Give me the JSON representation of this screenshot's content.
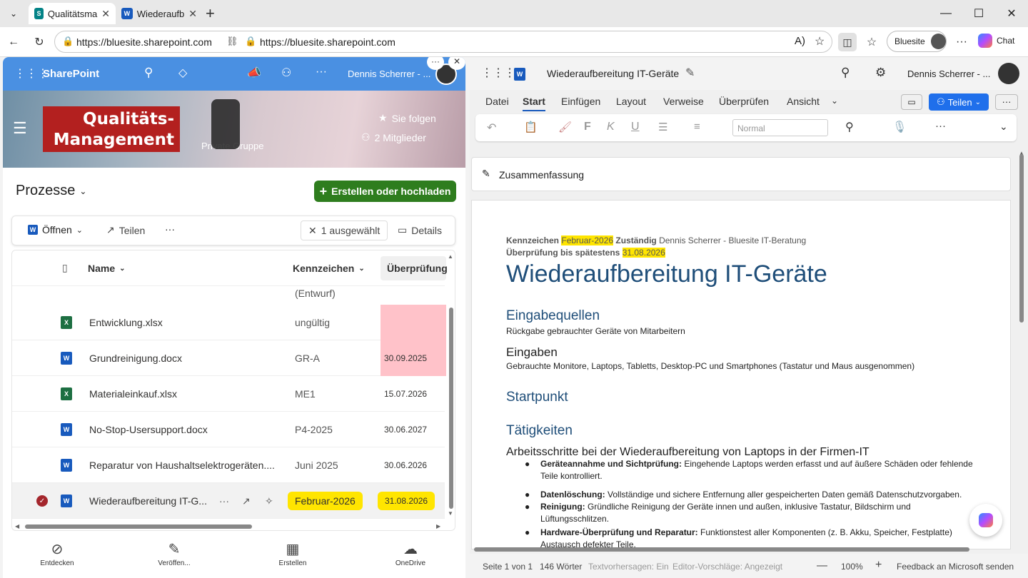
{
  "browser": {
    "tabs": [
      {
        "title": "Qualitätsma",
        "favicon": "S"
      },
      {
        "title": "Wiederaufb",
        "favicon": "W"
      }
    ],
    "url_left": "https://bluesite.sharepoint.com",
    "url_right": "https://bluesite.sharepoint.com",
    "profile": "Bluesite",
    "chat": "Chat"
  },
  "sharepoint": {
    "app": "SharePoint",
    "user": "Dennis Scherrer - ...",
    "site_logo_line1": "Qualitäts-",
    "site_logo_line2": "Management",
    "group_type": "Private Gruppe",
    "follow": "Sie folgen",
    "members": "2 Mitglieder",
    "library": "Prozesse",
    "create_button": "Erstellen oder hochladen",
    "cmd": {
      "open": "Öffnen",
      "share": "Teilen",
      "more": "···",
      "selected": "1 ausgewählt",
      "details": "Details"
    },
    "columns": {
      "name": "Name",
      "kennzeichen": "Kennzeichen",
      "ueberpruefung": "Überprüfung"
    },
    "partial_row": "(Entwurf)",
    "rows": [
      {
        "name": "Entwicklung.xlsx",
        "type": "xlsx",
        "kennzeichen": "ungültig",
        "ueberpruefung": "",
        "flag": "red"
      },
      {
        "name": "Grundreinigung.docx",
        "type": "docx",
        "kennzeichen": "GR-A",
        "ueberpruefung": "30.09.2025",
        "flag": "red"
      },
      {
        "name": "Materialeinkauf.xlsx",
        "type": "xlsx",
        "kennzeichen": "ME1",
        "ueberpruefung": "15.07.2026",
        "flag": ""
      },
      {
        "name": "No-Stop-Usersupport.docx",
        "type": "docx",
        "kennzeichen": "P4-2025",
        "ueberpruefung": "30.06.2027",
        "flag": ""
      },
      {
        "name": "Reparatur von Haushaltselektrogeräten....",
        "type": "docx",
        "kennzeichen": "Juni 2025",
        "ueberpruefung": "30.06.2026",
        "flag": ""
      },
      {
        "name": "Wiederaufbereitung IT-G...",
        "type": "docx",
        "kennzeichen": "Februar-2026",
        "ueberpruefung": "31.08.2026",
        "flag": "yellow"
      }
    ],
    "bottom_nav": [
      "Entdecken",
      "Veröffen...",
      "Erstellen",
      "OneDrive"
    ]
  },
  "word": {
    "doc_title": "Wiederaufbereitung IT-Geräte",
    "user": "Dennis Scherrer - ...",
    "tabs": [
      "Datei",
      "Start",
      "Einfügen",
      "Layout",
      "Verweise",
      "Überprüfen",
      "Ansicht"
    ],
    "share": "Teilen",
    "style_box": "Normal",
    "summary": "Zusammenfassung",
    "content": {
      "k_label": "Kennzeichen ",
      "k_value": "Februar-2026",
      "z_label": " Zuständig",
      "z_value": " Dennis Scherrer - Bluesite IT-Beratung",
      "u_label": "Überprüfung bis spätestens ",
      "u_value": "31.08.2026",
      "title": "Wiederaufbereitung IT-Geräte",
      "h_eingabequellen": "Eingabequellen",
      "t_eingabequellen": "Rückgabe gebrauchter Geräte von Mitarbeitern",
      "h_eingaben": "Eingaben",
      "t_eingaben": "Gebrauchte Monitore, Laptops, Tabletts, Desktop-PC und Smartphones (Tastatur und Maus ausgenommen)",
      "h_startpunkt": "Startpunkt",
      "h_taetigkeiten": "Tätigkeiten",
      "t_arbeitsschritte": "Arbeitsschritte bei der Wiederaufbereitung von Laptops in der Firmen-IT",
      "bullets": [
        {
          "b": "Geräteannahme und Sichtprüfung:",
          "t": " Eingehende Laptops werden erfasst und auf äußere Schäden oder fehlende",
          "t2": "Teile kontrolliert."
        },
        {
          "b": "Datenlöschung:",
          "t": " Vollständige und sichere Entfernung aller gespeicherten Daten gemäß Datenschutzvorgaben.",
          "t2": ""
        },
        {
          "b": "Reinigung:",
          "t": " Gründliche Reinigung der Geräte innen und außen, inklusive Tastatur, Bildschirm und",
          "t2": "Lüftungsschlitzen."
        },
        {
          "b": "Hardware-Überprüfung und Reparatur:",
          "t": " Funktionstest aller Komponenten (z. B. Akku, Speicher, Festplatte)",
          "t2": "Austausch defekter Teile."
        }
      ]
    },
    "status": {
      "page": "Seite 1 von 1",
      "words": "146 Wörter",
      "pred": "Textvorhersagen: Ein",
      "editor": "Editor-Vorschläge: Angezeigt",
      "zoom": "100%",
      "feedback": "Feedback an Microsoft senden"
    }
  },
  "colors": {
    "sp_blue": "#4a90e2",
    "create_green": "#2e7d1e",
    "word_blue": "#1f6feb",
    "highlight": "#ffe500",
    "flag_red": "#ffc2c9"
  }
}
